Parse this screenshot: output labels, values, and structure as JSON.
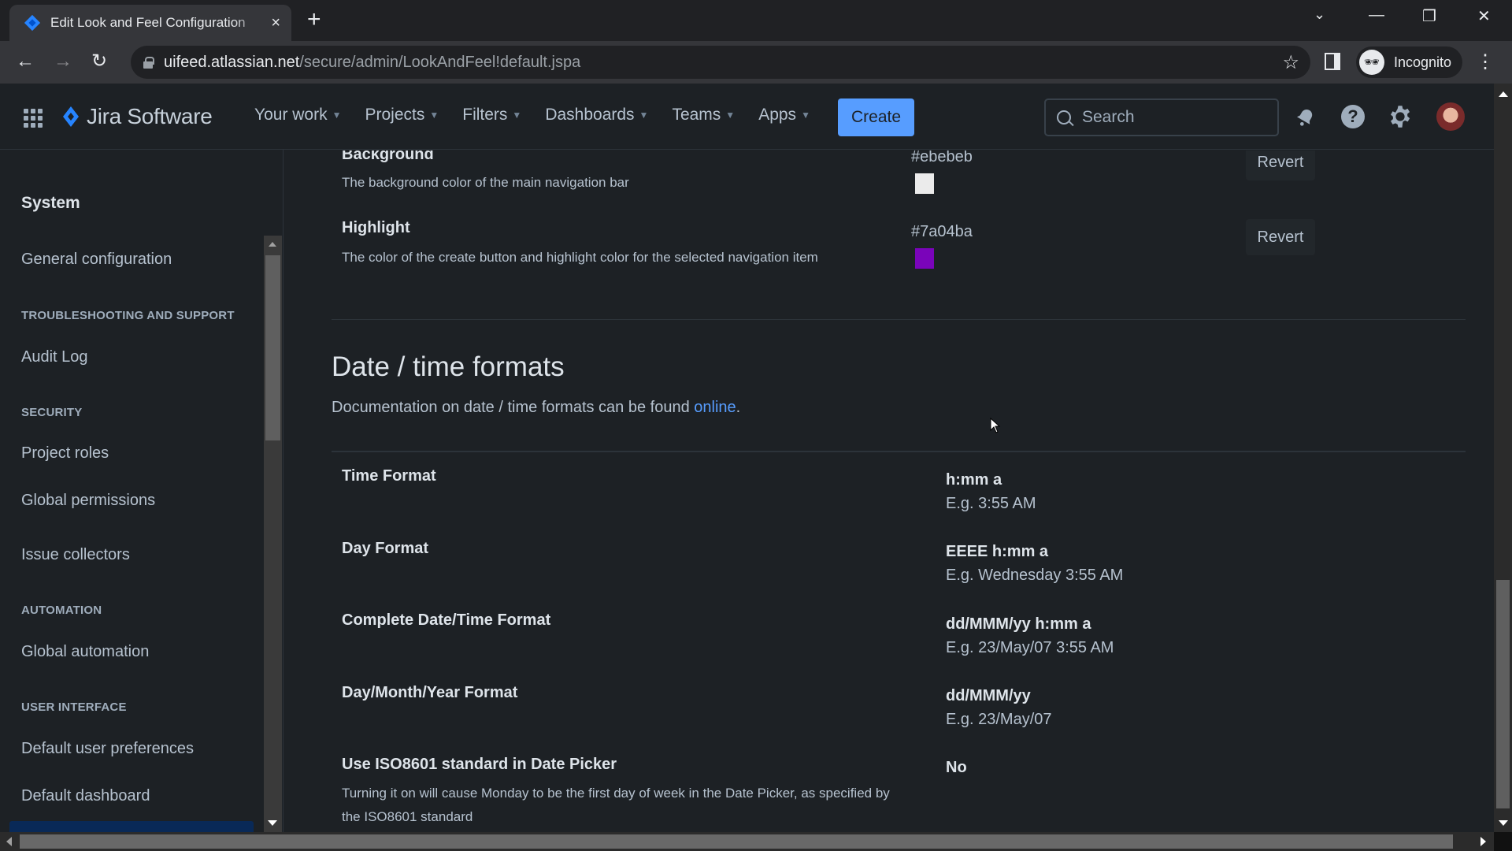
{
  "browser": {
    "tab_title": "Edit Look and Feel Configuration",
    "tab_close": "×",
    "new_tab": "+",
    "url_host": "uifeed.atlassian.net",
    "url_path": "/secure/admin/LookAndFeel!default.jspa",
    "incognito_label": "Incognito",
    "window_controls": {
      "tab_search": "⌄",
      "minimize": "—",
      "restore": "❐",
      "close": "✕"
    },
    "nav": {
      "back": "←",
      "forward": "→",
      "reload": "↻"
    },
    "bookmark": "☆",
    "menu": "⋮"
  },
  "header": {
    "product_name": "Jira Software",
    "menu": [
      {
        "label": "Your work"
      },
      {
        "label": "Projects"
      },
      {
        "label": "Filters"
      },
      {
        "label": "Dashboards"
      },
      {
        "label": "Teams"
      },
      {
        "label": "Apps"
      }
    ],
    "create_label": "Create",
    "search_placeholder": "Search",
    "brand_color": "#579dff"
  },
  "sidebar": {
    "title": "System",
    "items": [
      {
        "type": "item",
        "label": "General configuration"
      },
      {
        "type": "heading",
        "label": "TROUBLESHOOTING AND SUPPORT"
      },
      {
        "type": "item",
        "label": "Audit Log"
      },
      {
        "type": "heading",
        "label": "SECURITY"
      },
      {
        "type": "item",
        "label": "Project roles"
      },
      {
        "type": "item",
        "label": "Global permissions"
      },
      {
        "type": "item",
        "label": "Issue collectors"
      },
      {
        "type": "heading",
        "label": "AUTOMATION"
      },
      {
        "type": "item",
        "label": "Global automation"
      },
      {
        "type": "heading",
        "label": "USER INTERFACE"
      },
      {
        "type": "item",
        "label": "Default user preferences"
      },
      {
        "type": "item",
        "label": "Default dashboard"
      }
    ]
  },
  "colors": [
    {
      "label": "Background",
      "description": "The background color of the main navigation bar",
      "hex": "#ebebeb",
      "revert_label": "Revert"
    },
    {
      "label": "Highlight",
      "description": "The color of the create button and highlight color for the selected navigation item",
      "hex": "#7a04ba",
      "revert_label": "Revert"
    }
  ],
  "date_time": {
    "title": "Date / time formats",
    "doc_text": "Documentation on date / time formats can be found ",
    "doc_link": "online",
    "doc_suffix": ".",
    "formats": [
      {
        "label": "Time Format",
        "value": "h:mm a",
        "example": "E.g. 3:55 AM"
      },
      {
        "label": "Day Format",
        "value": "EEEE h:mm a",
        "example": "E.g. Wednesday 3:55 AM"
      },
      {
        "label": "Complete Date/Time Format",
        "value": "dd/MMM/yy h:mm a",
        "example": "E.g. 23/May/07 3:55 AM"
      },
      {
        "label": "Day/Month/Year Format",
        "value": "dd/MMM/yy",
        "example": "E.g. 23/May/07"
      }
    ],
    "iso": {
      "label": "Use ISO8601 standard in Date Picker",
      "description_line1": "Turning it on will cause Monday to be the first day of week in the Date Picker, as specified by",
      "description_line2": "the ISO8601 standard",
      "value": "No"
    }
  }
}
